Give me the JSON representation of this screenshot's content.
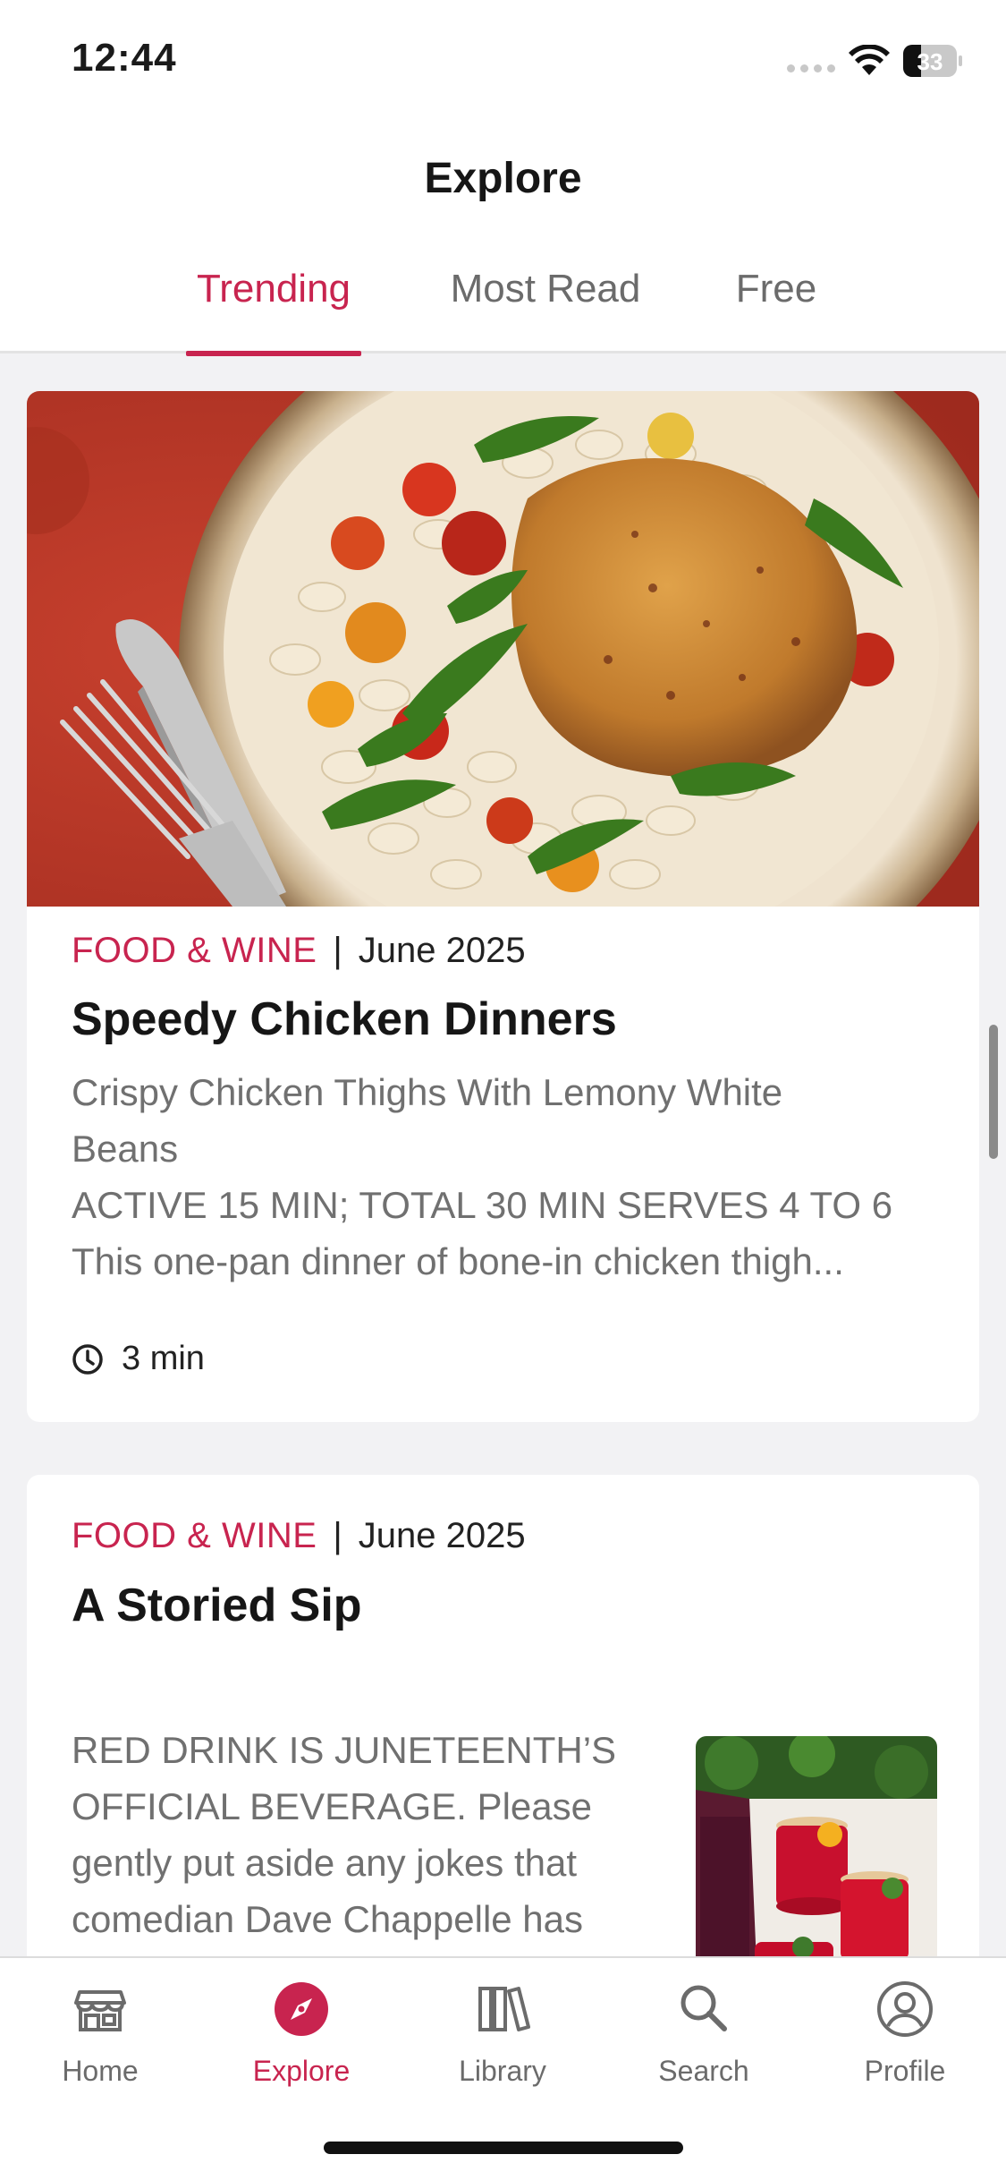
{
  "status_bar": {
    "time": "12:44",
    "battery_level": "33",
    "battery_fraction": 0.33,
    "icons": [
      "signal-icon",
      "wifi-icon",
      "battery-icon"
    ]
  },
  "header": {
    "title": "Explore",
    "tabs": [
      {
        "label": "Trending",
        "active": true
      },
      {
        "label": "Most Read",
        "active": false
      },
      {
        "label": "Free",
        "active": false
      }
    ]
  },
  "articles": [
    {
      "source": "FOOD & WINE",
      "separator": "|",
      "date": "June 2025",
      "title": "Speedy Chicken Dinners",
      "excerpt_lines": [
        "Crispy Chicken Thighs With Lemony White",
        "Beans",
        "ACTIVE 15 MIN; TOTAL 30 MIN SERVES 4 TO 6",
        "This one-pan dinner of bone-in chicken thigh..."
      ],
      "read_time": "3 min",
      "image": "chicken-thigh-white-beans-photo"
    },
    {
      "source": "FOOD & WINE",
      "separator": "|",
      "date": "June 2025",
      "title": "A Storied Sip",
      "excerpt_lines": [
        "RED DRINK IS JUNETEENTH’S",
        "OFFICIAL BEVERAGE. Please",
        "gently put aside any jokes that",
        "comedian Dave Chappelle has"
      ],
      "image": "red-drink-glasses-photo"
    }
  ],
  "tabbar": {
    "items": [
      {
        "label": "Home",
        "icon": "home-icon",
        "active": false
      },
      {
        "label": "Explore",
        "icon": "compass-icon",
        "active": true
      },
      {
        "label": "Library",
        "icon": "library-icon",
        "active": false
      },
      {
        "label": "Search",
        "icon": "search-icon",
        "active": false
      },
      {
        "label": "Profile",
        "icon": "profile-icon",
        "active": false
      }
    ]
  },
  "colors": {
    "accent": "#c8244f",
    "inactive": "#6b6b6b",
    "background": "#f2f2f4"
  }
}
